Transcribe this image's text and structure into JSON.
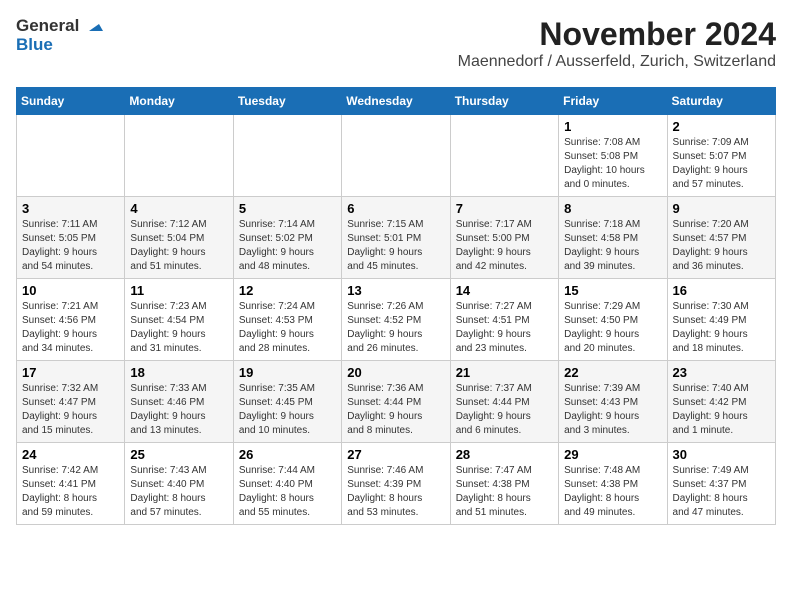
{
  "app": {
    "logo_line1": "General",
    "logo_line2": "Blue"
  },
  "header": {
    "month_year": "November 2024",
    "location": "Maennedorf / Ausserfeld, Zurich, Switzerland"
  },
  "weekdays": [
    "Sunday",
    "Monday",
    "Tuesday",
    "Wednesday",
    "Thursday",
    "Friday",
    "Saturday"
  ],
  "weeks": [
    [
      {
        "day": "",
        "info": ""
      },
      {
        "day": "",
        "info": ""
      },
      {
        "day": "",
        "info": ""
      },
      {
        "day": "",
        "info": ""
      },
      {
        "day": "",
        "info": ""
      },
      {
        "day": "1",
        "info": "Sunrise: 7:08 AM\nSunset: 5:08 PM\nDaylight: 10 hours\nand 0 minutes."
      },
      {
        "day": "2",
        "info": "Sunrise: 7:09 AM\nSunset: 5:07 PM\nDaylight: 9 hours\nand 57 minutes."
      }
    ],
    [
      {
        "day": "3",
        "info": "Sunrise: 7:11 AM\nSunset: 5:05 PM\nDaylight: 9 hours\nand 54 minutes."
      },
      {
        "day": "4",
        "info": "Sunrise: 7:12 AM\nSunset: 5:04 PM\nDaylight: 9 hours\nand 51 minutes."
      },
      {
        "day": "5",
        "info": "Sunrise: 7:14 AM\nSunset: 5:02 PM\nDaylight: 9 hours\nand 48 minutes."
      },
      {
        "day": "6",
        "info": "Sunrise: 7:15 AM\nSunset: 5:01 PM\nDaylight: 9 hours\nand 45 minutes."
      },
      {
        "day": "7",
        "info": "Sunrise: 7:17 AM\nSunset: 5:00 PM\nDaylight: 9 hours\nand 42 minutes."
      },
      {
        "day": "8",
        "info": "Sunrise: 7:18 AM\nSunset: 4:58 PM\nDaylight: 9 hours\nand 39 minutes."
      },
      {
        "day": "9",
        "info": "Sunrise: 7:20 AM\nSunset: 4:57 PM\nDaylight: 9 hours\nand 36 minutes."
      }
    ],
    [
      {
        "day": "10",
        "info": "Sunrise: 7:21 AM\nSunset: 4:56 PM\nDaylight: 9 hours\nand 34 minutes."
      },
      {
        "day": "11",
        "info": "Sunrise: 7:23 AM\nSunset: 4:54 PM\nDaylight: 9 hours\nand 31 minutes."
      },
      {
        "day": "12",
        "info": "Sunrise: 7:24 AM\nSunset: 4:53 PM\nDaylight: 9 hours\nand 28 minutes."
      },
      {
        "day": "13",
        "info": "Sunrise: 7:26 AM\nSunset: 4:52 PM\nDaylight: 9 hours\nand 26 minutes."
      },
      {
        "day": "14",
        "info": "Sunrise: 7:27 AM\nSunset: 4:51 PM\nDaylight: 9 hours\nand 23 minutes."
      },
      {
        "day": "15",
        "info": "Sunrise: 7:29 AM\nSunset: 4:50 PM\nDaylight: 9 hours\nand 20 minutes."
      },
      {
        "day": "16",
        "info": "Sunrise: 7:30 AM\nSunset: 4:49 PM\nDaylight: 9 hours\nand 18 minutes."
      }
    ],
    [
      {
        "day": "17",
        "info": "Sunrise: 7:32 AM\nSunset: 4:47 PM\nDaylight: 9 hours\nand 15 minutes."
      },
      {
        "day": "18",
        "info": "Sunrise: 7:33 AM\nSunset: 4:46 PM\nDaylight: 9 hours\nand 13 minutes."
      },
      {
        "day": "19",
        "info": "Sunrise: 7:35 AM\nSunset: 4:45 PM\nDaylight: 9 hours\nand 10 minutes."
      },
      {
        "day": "20",
        "info": "Sunrise: 7:36 AM\nSunset: 4:44 PM\nDaylight: 9 hours\nand 8 minutes."
      },
      {
        "day": "21",
        "info": "Sunrise: 7:37 AM\nSunset: 4:44 PM\nDaylight: 9 hours\nand 6 minutes."
      },
      {
        "day": "22",
        "info": "Sunrise: 7:39 AM\nSunset: 4:43 PM\nDaylight: 9 hours\nand 3 minutes."
      },
      {
        "day": "23",
        "info": "Sunrise: 7:40 AM\nSunset: 4:42 PM\nDaylight: 9 hours\nand 1 minute."
      }
    ],
    [
      {
        "day": "24",
        "info": "Sunrise: 7:42 AM\nSunset: 4:41 PM\nDaylight: 8 hours\nand 59 minutes."
      },
      {
        "day": "25",
        "info": "Sunrise: 7:43 AM\nSunset: 4:40 PM\nDaylight: 8 hours\nand 57 minutes."
      },
      {
        "day": "26",
        "info": "Sunrise: 7:44 AM\nSunset: 4:40 PM\nDaylight: 8 hours\nand 55 minutes."
      },
      {
        "day": "27",
        "info": "Sunrise: 7:46 AM\nSunset: 4:39 PM\nDaylight: 8 hours\nand 53 minutes."
      },
      {
        "day": "28",
        "info": "Sunrise: 7:47 AM\nSunset: 4:38 PM\nDaylight: 8 hours\nand 51 minutes."
      },
      {
        "day": "29",
        "info": "Sunrise: 7:48 AM\nSunset: 4:38 PM\nDaylight: 8 hours\nand 49 minutes."
      },
      {
        "day": "30",
        "info": "Sunrise: 7:49 AM\nSunset: 4:37 PM\nDaylight: 8 hours\nand 47 minutes."
      }
    ]
  ]
}
